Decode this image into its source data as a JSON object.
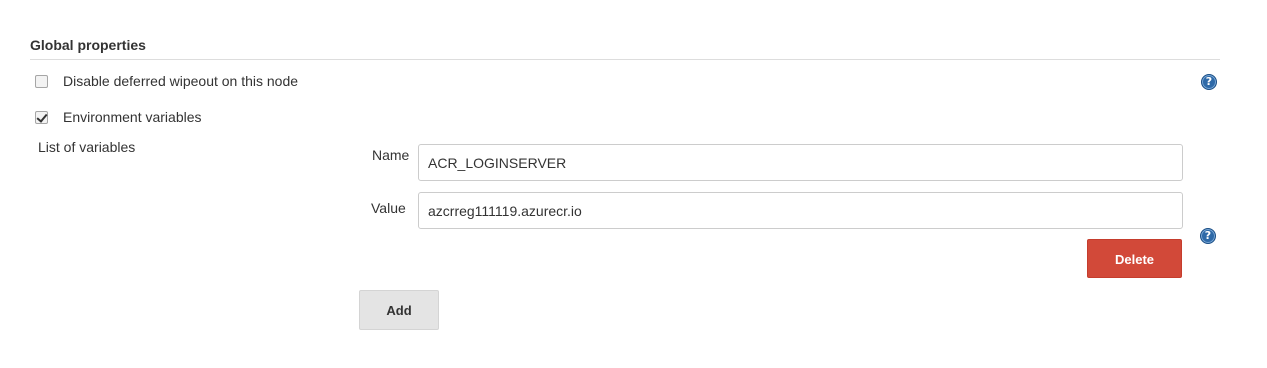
{
  "section": {
    "title": "Global properties"
  },
  "options": {
    "disable_wipeout": {
      "label": "Disable deferred wipeout on this node",
      "checked": false
    },
    "env_vars": {
      "label": "Environment variables",
      "checked": true
    }
  },
  "env_vars": {
    "list_label": "List of variables",
    "name_label": "Name",
    "name_value": "ACR_LOGINSERVER",
    "value_label": "Value",
    "value_value": "azcrreg111119.azurecr.io",
    "delete_label": "Delete",
    "add_label": "Add"
  },
  "help": {
    "glyph": "?"
  },
  "icons": {
    "help": "help-icon"
  },
  "colors": {
    "delete_button": "#d24939",
    "add_button": "#e4e4e4",
    "help_icon": "#2f6aa8"
  }
}
